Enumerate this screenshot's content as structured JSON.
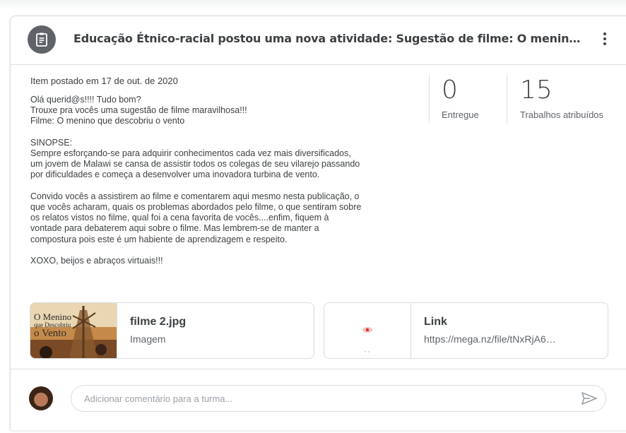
{
  "header": {
    "title": "Educação Étnico-racial postou uma nova atividade: Sugestão de filme: O menino que descobriu o vento",
    "icon": "assignment-icon",
    "menu_icon": "more-vert-icon"
  },
  "post": {
    "posted_date": "Item postado em 17 de out. de 2020",
    "paragraphs": [
      "Olá querid@s!!!! Tudo bom?\nTrouxe pra vocês uma sugestão de filme maravilhosa!!!\nFilme: O menino que descobriu o vento",
      "SINOPSE:\nSempre esforçando-se para adquirir conhecimentos cada vez mais diversificados,\num jovem de Malawi se cansa de assistir todos os colegas de seu vilarejo passando\npor dificuldades e começa a desenvolver uma inovadora turbina de vento.",
      "Convido vocês a assistirem ao filme e comentarem aqui mesmo nesta publicação, o\nque vocês acharam, quais os problemas abordados pelo filme, o que sentiram sobre\nos relatos vistos no filme, qual foi a cena favorita de vocês....enfim, fiquem à\nvontade para debaterem aqui sobre o filme. Mas lembrem-se de manter a\ncompostura pois este é um habiente de aprendizagem e respeito.",
      "XOXO, beijos e abraços virtuais!!!"
    ]
  },
  "stats": {
    "handed_in": {
      "value": "0",
      "label": "Entregue"
    },
    "assigned": {
      "value": "15",
      "label": "Trabalhos atribuídos"
    }
  },
  "attachments": [
    {
      "title": "filme 2.jpg",
      "subtitle": "Imagem",
      "thumb_text": [
        "O Menino",
        "que Descobriu",
        "o Vento"
      ]
    },
    {
      "title": "Link",
      "subtitle": "https://mega.nz/file/tNxRjA6…"
    }
  ],
  "comment": {
    "placeholder": "Adicionar comentário para a turma...",
    "send_icon": "send-icon"
  },
  "colors": {
    "text": "#3c4043",
    "secondary": "#5f6368",
    "border": "#dadce0",
    "icon_bg": "#5f6368"
  }
}
